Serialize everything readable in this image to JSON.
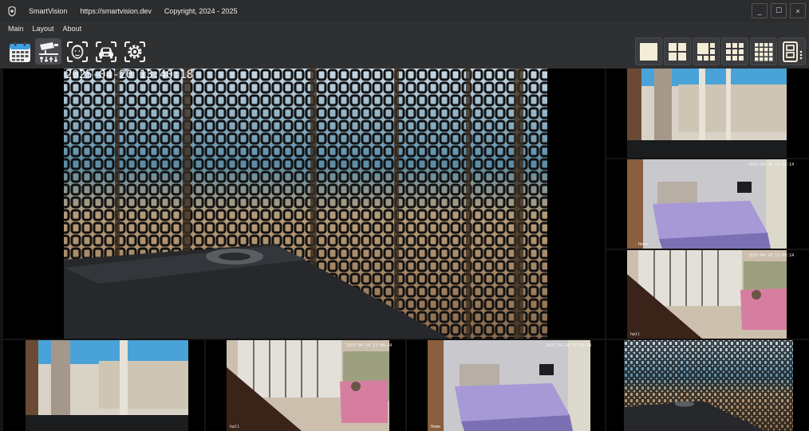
{
  "window": {
    "app_name": "SmartVision",
    "url": "https://smartvision.dev",
    "copyright": "Copyright, 2024 - 2025",
    "controls": {
      "minimize": "_",
      "maximize": "☐",
      "close": "×"
    }
  },
  "menu": {
    "items": [
      "Main",
      "Layout",
      "About"
    ]
  },
  "toolbar": {
    "tools": [
      "calendar-icon",
      "camera-settings-icon",
      "face-recognition-icon",
      "vehicle-recognition-icon",
      "settings-icon"
    ],
    "active_tool": "camera-settings-icon",
    "layouts": [
      "layout-1x1-icon",
      "layout-2x2-icon",
      "layout-1plus5-icon",
      "layout-3x3-icon",
      "layout-4x4-icon",
      "layout-custom-icon"
    ]
  },
  "cameras": {
    "main": {
      "timestamp": "2025-04-20   13:40:18"
    },
    "bedroom_right": {
      "timestamp": "2025-04-20 13:40:14",
      "name": "Home"
    },
    "living_right": {
      "timestamp": "2025-04-20 13:40:14",
      "name": "hall"
    },
    "living_bottom": {
      "timestamp": "2025-04-20 13:40:14",
      "name": "hall"
    },
    "bedroom_bottom": {
      "timestamp": "2025-04-20 13:40:14",
      "name": "Home"
    }
  },
  "colors": {
    "accent": "#e9e1c9",
    "panel": "#2f3032",
    "titlebar": "#2b2c2e"
  }
}
